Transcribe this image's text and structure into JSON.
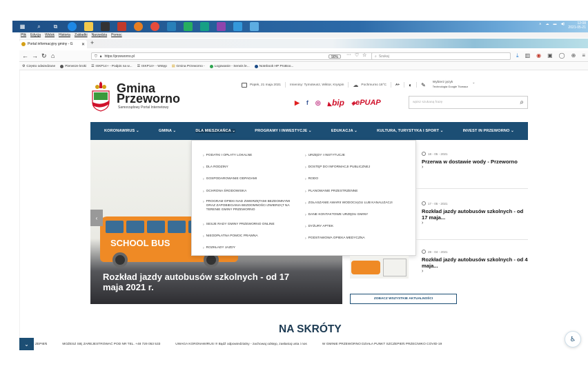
{
  "taskbar": {
    "clock_time": "12:08",
    "clock_date": "2021-05-21"
  },
  "browser": {
    "menu": [
      "Plik",
      "Edycja",
      "Widok",
      "Historia",
      "Zakładki",
      "Narzędzia",
      "Pomoc"
    ],
    "tab_title": "Portal informacyjny gminy - G",
    "url": "https://przeworno.pl",
    "zoom": "90%",
    "search_placeholder": "Szukaj",
    "bookmarks": [
      "Często odwiedzane",
      "Pierwsze kroki",
      "ISKP14+ - Podpis na w...",
      "ISKP14+ - Wstęp",
      "Gmina Przeworno -",
      "Logowanie - Serwis le...",
      "Notebook HP ProBoo..."
    ]
  },
  "site": {
    "logo_line1": "Gmina",
    "logo_line2": "Przeworno",
    "logo_sub": "Samorządowy Portal Internetowy",
    "date": "Piątek, 21 maja 2021",
    "nameday": "Imieniny: Tymoteusz, Wiktor, Kryspin",
    "weather": "Pochmurno 18°C",
    "font_size": "A+",
    "lang_label": "Wybierz język",
    "lang_tech": "Technologia Google Tłumacz",
    "bip": "bip",
    "epuap": "ePUAP",
    "search_placeholder": "wpisz szukaną frazę"
  },
  "nav": [
    "KORONAWIRUS",
    "GMINA",
    "DLA MIESZKAŃCA",
    "PROGRAMY I INWESTYCJE",
    "EDUKACJA",
    "KULTURA, TURYSTYKA I SPORT",
    "INVEST IN PRZEWORNO"
  ],
  "dropdown": {
    "left": [
      "PODATKI I OPŁATY LOKALNE",
      "DLA RODZINY",
      "GOSPODAROWANIE ODPADAMI",
      "OCHRONA ŚRODOWISKA",
      "PROGRAM OPIEKI NAD ZWIERZĘTAMI BEZDOMNYMI ORAZ ZAPOBIEGANIA BEZDOMNOŚCI ZWIERZĄT NA TERENIE GMINY PRZEWORNO",
      "SESJE RADY GMINY PRZEWORNO ONLINE",
      "NIEODPŁATNA POMOC PRAWNA",
      "ROZKŁADY JAZDY"
    ],
    "right": [
      "URZĘDY I INSTYTUCJE",
      "DOSTĘP DO INFORMACJI PUBLICZNEJ",
      "RODO",
      "PLANOWANIE PRZESTRZENNE",
      "ZGŁASZANIE AWARII WODOCIĄGU LUB KANALIZACJI",
      "DANE KONTAKTOWE URZĘDU GMINY",
      "DYŻURY APTEK",
      "PODSTAWOWA OPIEKA MEDYCZNA"
    ]
  },
  "hero": {
    "bus_text": "SCHOOL BUS",
    "caption": "Rozkład jazdy autobusów szkolnych - od 17 maja 2021 r."
  },
  "news": [
    {
      "date": "18 - 05 - 2021",
      "title": "Przerwa w dostawie wody - Przeworno"
    },
    {
      "date": "17 - 05 - 2021",
      "title": "Rozkład jazdy autobusów szkolnych - od 17 maja..."
    },
    {
      "date": "28 - 04 - 2021",
      "title": "Rozkład jazdy autobusów szkolnych - od 4 maja..."
    }
  ],
  "all_news": "ZOBACZ WSZYSTKIE AKTUALNOŚCI",
  "shortcuts_title": "NA SKRÓTY",
  "ticker": [
    "ZEPIEŃ",
    "MOŻESZ SIĘ ZAREJESTROWAĆ POD NR TEL. +48 729 053 533",
    "UWAGA KORONAWIRUS !!! Bądź odpowiedzialny - zachowaj odstęp, zasłaniaj usta i nos",
    "W GMINIE PRZEWORNO DZIAŁA PUNKT SZCZEPIEŃ PRZECIWKO COVID-19"
  ],
  "colors": {
    "nav": "#1c4e74",
    "accent": "#d0102a",
    "bus": "#ef8a25"
  }
}
